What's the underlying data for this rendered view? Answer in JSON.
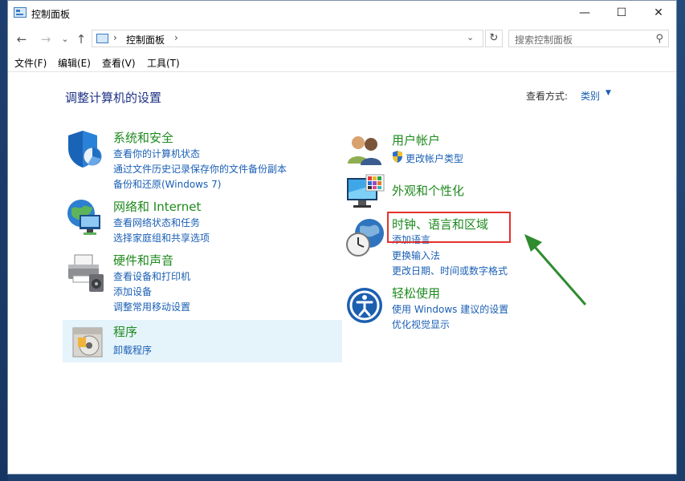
{
  "window": {
    "title": "控制面板",
    "minimize_glyph": "—",
    "maximize_glyph": "☐",
    "close_glyph": "✕"
  },
  "nav": {
    "back_glyph": "←",
    "forward_glyph": "→",
    "recent_glyph": "⌄",
    "up_glyph": "↑"
  },
  "address": {
    "separator": "›",
    "crumb": "控制面板",
    "dropdown_glyph": "⌄",
    "refresh_glyph": "↻"
  },
  "search": {
    "placeholder": "搜索控制面板",
    "icon_glyph": "⚲"
  },
  "menu": [
    "文件(F)",
    "编辑(E)",
    "查看(V)",
    "工具(T)"
  ],
  "main": {
    "heading": "调整计算机的设置",
    "view_by_label": "查看方式:",
    "view_by_value": "类别",
    "view_by_arrow": "▼"
  },
  "categories_left": [
    {
      "title": "系统和安全",
      "links": [
        "查看你的计算机状态",
        "通过文件历史记录保存你的文件备份副本",
        "备份和还原(Windows 7)"
      ]
    },
    {
      "title": "网络和 Internet",
      "links": [
        "查看网络状态和任务",
        "选择家庭组和共享选项"
      ]
    },
    {
      "title": "硬件和声音",
      "links": [
        "查看设备和打印机",
        "添加设备",
        "调整常用移动设置"
      ]
    },
    {
      "title": "程序",
      "links": [
        "卸载程序"
      ]
    }
  ],
  "categories_right": [
    {
      "title": "用户帐户",
      "links": [
        "更改帐户类型"
      ]
    },
    {
      "title": "外观和个性化",
      "links": []
    },
    {
      "title": "时钟、语言和区域",
      "links": [
        "添加语言",
        "更换输入法",
        "更改日期、时间或数字格式"
      ]
    },
    {
      "title": "轻松使用",
      "links": [
        "使用 Windows 建议的设置",
        "优化视觉显示"
      ]
    }
  ],
  "colors": {
    "category_title": "#1e8a1e",
    "link": "#1a5fb4",
    "heading": "#1e3287",
    "highlight_box": "#e5322d",
    "arrow": "#2e8b2e"
  }
}
